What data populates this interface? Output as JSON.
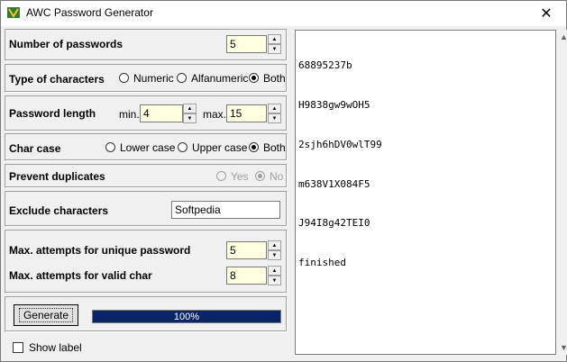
{
  "window": {
    "title": "AWC Password Generator",
    "close_glyph": "✕"
  },
  "num_passwords": {
    "label": "Number of passwords",
    "value": "5"
  },
  "char_type": {
    "label": "Type of characters",
    "options": [
      "Numeric",
      "Alfanumeric",
      "Both"
    ],
    "selected": "Both"
  },
  "pwd_length": {
    "label": "Password length",
    "min_label": "min.",
    "min_value": "4",
    "max_label": "max.",
    "max_value": "15"
  },
  "char_case": {
    "label": "Char case",
    "options": [
      "Lower case",
      "Upper case",
      "Both"
    ],
    "selected": "Both"
  },
  "prevent_dup": {
    "label": "Prevent duplicates",
    "options": [
      "Yes",
      "No"
    ],
    "selected": "No",
    "disabled": true
  },
  "exclude": {
    "label": "Exclude characters",
    "value": "Softpedia"
  },
  "attempts": {
    "unique_label": "Max. attempts for unique password",
    "unique_value": "5",
    "valid_label": "Max. attempts for valid char",
    "valid_value": "8"
  },
  "generate": {
    "label": "Generate",
    "progress_text": "100%",
    "progress": 1.0
  },
  "show_label": {
    "label": "Show label",
    "checked": false
  },
  "output": {
    "lines": [
      "68895237b",
      "H9838gw9wOH5",
      "2sjh6hDV0wlT99",
      "m638V1X084F5",
      "J94I8g42TEI0",
      "finished"
    ]
  },
  "colors": {
    "input_bg": "#ffffe1",
    "progress_fill": "#0a246a",
    "window_bg": "#f0f0f0"
  }
}
